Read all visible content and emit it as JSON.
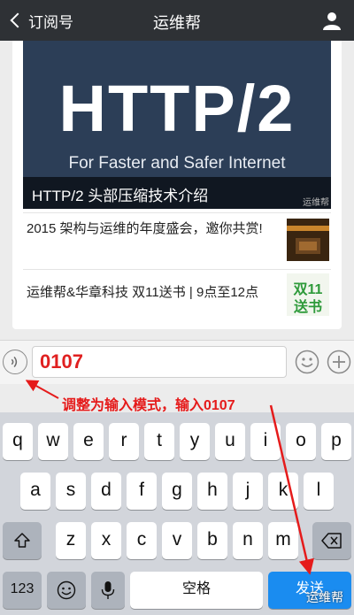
{
  "nav": {
    "back_label": "订阅号",
    "title": "运维帮"
  },
  "card": {
    "banner_big": "HTTP/2",
    "banner_sub": "For Faster and Safer Internet",
    "banner_caption": "HTTP/2 头部压缩技术介绍",
    "banner_watermark": "运维帮",
    "rows": [
      {
        "text": "2015 架构与运维的年度盛会，邀你共赏!",
        "thumb": "architecture-event-thumbnail"
      },
      {
        "text": "运维帮&华章科技 双11送书 | 9点至12点",
        "thumb_line1": "双11",
        "thumb_line2": "送书"
      }
    ]
  },
  "input": {
    "value": "0107"
  },
  "annotation": "调整为输入模式，输入0107",
  "keyboard": {
    "row1": [
      "q",
      "w",
      "e",
      "r",
      "t",
      "y",
      "u",
      "i",
      "o",
      "p"
    ],
    "row2": [
      "a",
      "s",
      "d",
      "f",
      "g",
      "h",
      "j",
      "k",
      "l"
    ],
    "row3": [
      "z",
      "x",
      "c",
      "v",
      "b",
      "n",
      "m"
    ],
    "numbers_key": "123",
    "space_key": "空格",
    "send_key": "发送"
  },
  "watermark": "运维帮",
  "colors": {
    "nav_bg": "#2e3135",
    "annotation": "#e51b1b",
    "send_key": "#1a8cf0",
    "keyboard_bg": "#d2d5db"
  }
}
